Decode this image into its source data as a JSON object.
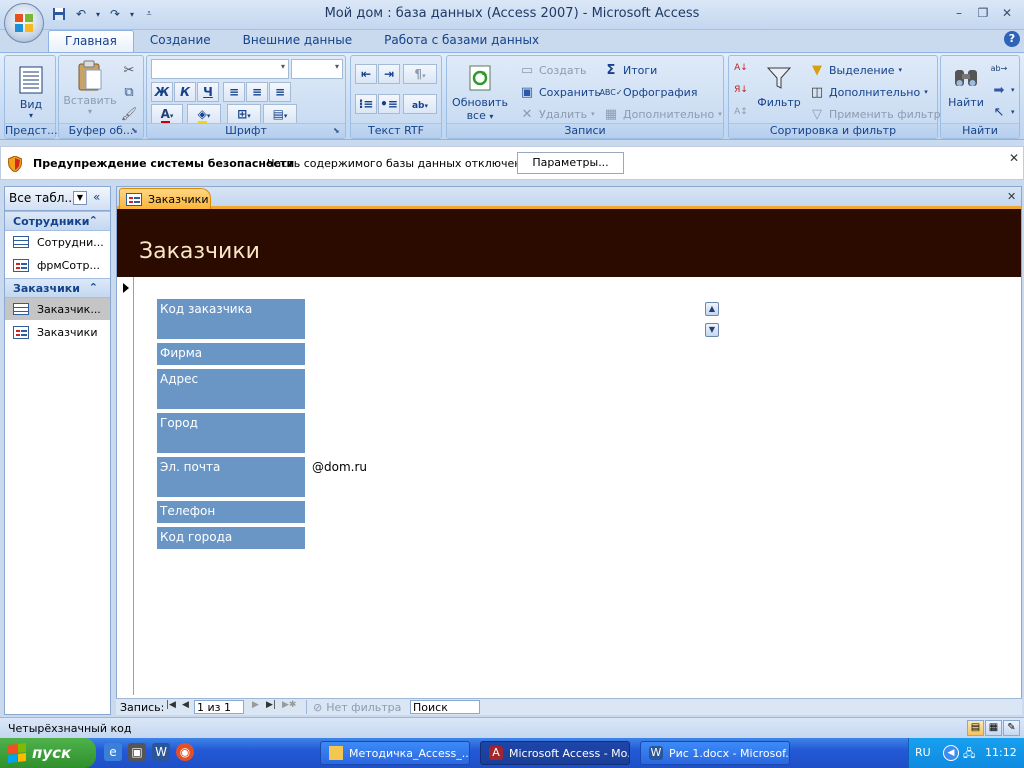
{
  "window": {
    "title": "Мой дом : база данных (Access 2007) - Microsoft Access",
    "controls": {
      "minimize": "–",
      "restore": "❐",
      "close": "✕"
    },
    "help": "?"
  },
  "quick_access": {
    "save_icon": "save-icon",
    "undo_icon": "undo-icon",
    "redo_icon": "redo-icon"
  },
  "ribbon_tabs": [
    {
      "label": "Главная",
      "active": true
    },
    {
      "label": "Создание"
    },
    {
      "label": "Внешние данные"
    },
    {
      "label": "Работа с базами данных"
    }
  ],
  "ribbon": {
    "views": {
      "label": "Предст...",
      "view_button": "Вид"
    },
    "clipboard": {
      "label": "Буфер об...",
      "paste_button": "Вставить"
    },
    "font": {
      "label": "Шрифт",
      "bold": "Ж",
      "italic": "К",
      "underline": "Ч",
      "font_name": "",
      "font_size": ""
    },
    "rtf": {
      "label": "Текст RTF"
    },
    "records": {
      "label": "Записи",
      "refresh_button": "Обновить",
      "refresh_sub": "все",
      "new": "Создать",
      "save": "Сохранить",
      "delete": "Удалить",
      "totals": "Итоги",
      "spelling": "Орфография",
      "more": "Дополнительно"
    },
    "sort_filter": {
      "label": "Сортировка и фильтр",
      "filter_button": "Фильтр",
      "selection": "Выделение",
      "advanced": "Дополнительно",
      "toggle_filter": "Применить фильтр"
    },
    "find": {
      "label": "Найти",
      "find_button": "Найти"
    }
  },
  "security_bar": {
    "title": "Предупреждение системы безопасности",
    "message": "Часть содержимого базы данных отключено",
    "options_button": "Параметры...",
    "close": "✕"
  },
  "nav_pane": {
    "header": "Все табл...",
    "groups": [
      {
        "label": "Сотрудники",
        "items": [
          {
            "label": "Сотрудни...",
            "type": "table"
          },
          {
            "label": "фрмСотр...",
            "type": "form"
          }
        ]
      },
      {
        "label": "Заказчики",
        "items": [
          {
            "label": "Заказчик...",
            "type": "table",
            "selected": true
          },
          {
            "label": "Заказчики",
            "type": "form"
          }
        ]
      }
    ]
  },
  "document": {
    "tab_label": "Заказчики",
    "form_title": "Заказчики",
    "fields": [
      {
        "label": "Код заказчика",
        "value": ""
      },
      {
        "label": "Фирма",
        "value": ""
      },
      {
        "label": "Адрес",
        "value": ""
      },
      {
        "label": "Город",
        "value": ""
      },
      {
        "label": "Эл. почта",
        "value": "@dom.ru"
      },
      {
        "label": "Телефон",
        "value": ""
      },
      {
        "label": "Код города",
        "value": ""
      }
    ]
  },
  "record_nav": {
    "label": "Запись:",
    "current": "1 из 1",
    "filter_status": "Нет фильтра",
    "search_placeholder": "Поиск"
  },
  "status_bar": {
    "text": "Четырёхзначный код"
  },
  "taskbar": {
    "start_label": "пуск",
    "tasks": [
      {
        "label": "Методичка_Access_...",
        "active": false
      },
      {
        "label": "Microsoft Access - Mo...",
        "active": true
      },
      {
        "label": "Рис 1.docx - Microsof...",
        "active": false
      }
    ],
    "tray": {
      "lang": "RU",
      "time": "11:12"
    }
  }
}
